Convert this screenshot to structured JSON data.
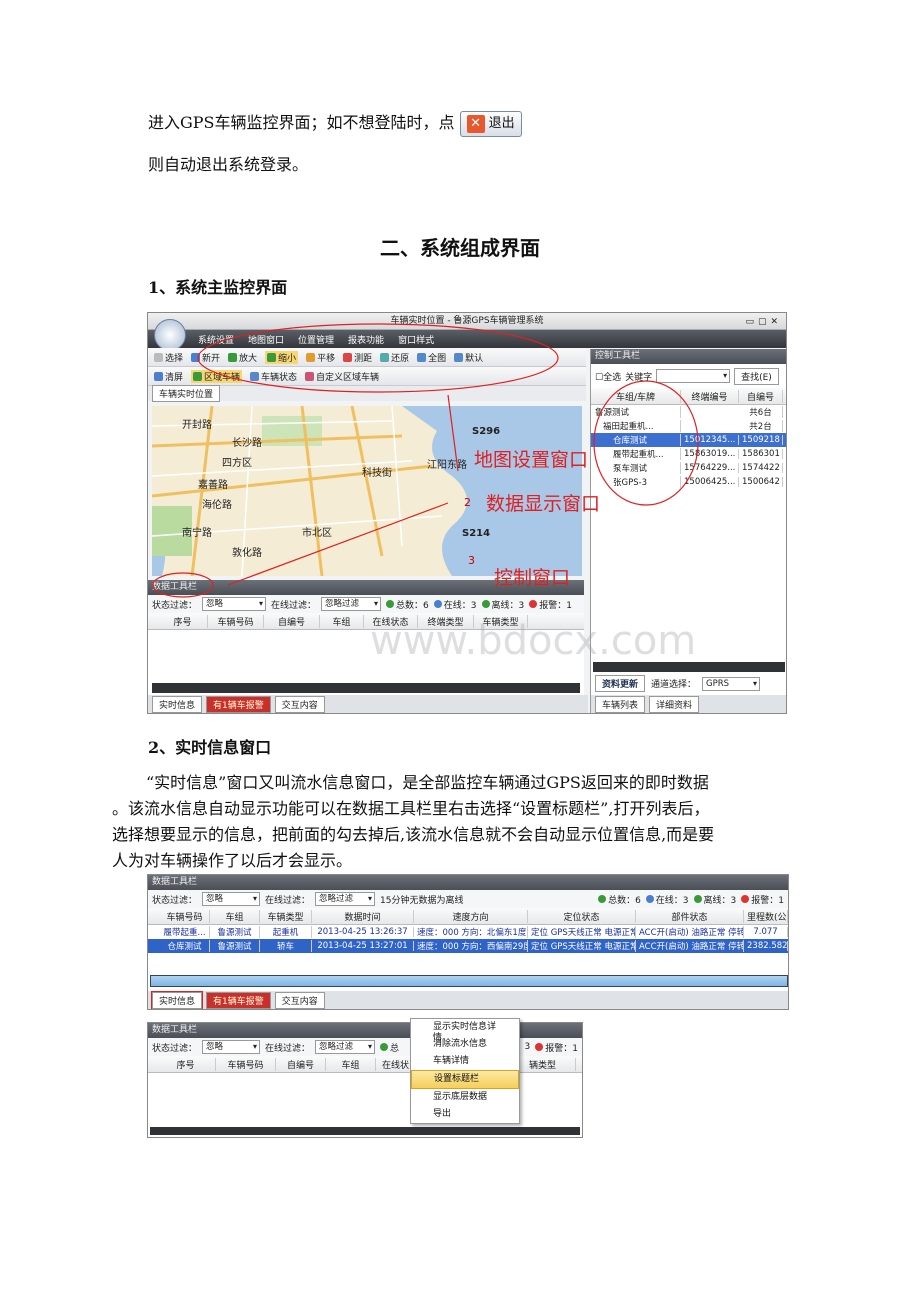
{
  "intro": {
    "line1": "进入GPS车辆监控界面；如不想登陆时，点",
    "exit_button": "退出",
    "line2": "则自动退出系统登录。"
  },
  "section2_title": "二、系统组成界面",
  "sub1_title": "1、系统主监控界面",
  "sub2_title": "2、实时信息窗口",
  "sub2_para": [
    "“实时信息”窗口又叫流水信息窗口，是全部监控车辆通过GPS返回来的即时数据",
    "。该流水信息自动显示功能可以在数据工具栏里右击选择“设置标题栏”,打开列表后，",
    "选择想要显示的信息，把前面的勾去掉后,该流水信息就不会自动显示位置信息,而是要",
    "人为对车辆操作了以后才会显示。"
  ],
  "main_ui": {
    "window_title": "车辆实时位置 - 鲁源GPS车辆管理系统",
    "menu": [
      "系统设置",
      "地图窗口",
      "位置管理",
      "报表功能",
      "窗口样式"
    ],
    "toolbar1": [
      "选择",
      "新开",
      "放大",
      "缩小",
      "平移",
      "测距",
      "还原",
      "全图",
      "默认"
    ],
    "toolbar2": [
      "清屏",
      "区域车辆",
      "车辆状态",
      "自定义区域车辆"
    ],
    "map_tab": "车辆实时位置",
    "map_labels": [
      "开封路",
      "长沙路",
      "四方区",
      "嘉善路",
      "海伦路",
      "南宁路",
      "敦化路",
      "市北区",
      "科技街",
      "S296",
      "S214",
      "江阳东路",
      "2",
      "3"
    ],
    "data_panel_title": "数据工具栏",
    "filter_state_label": "状态过滤：",
    "filter_state_value": "忽略",
    "filter_online_label": "在线过滤：",
    "filter_online_value": "忽略过滤",
    "stats": [
      "总数：6",
      "在线：3",
      "离线：3",
      "报警：1"
    ],
    "columns": [
      "序号",
      "车辆号码",
      "自编号",
      "车组",
      "在线状态",
      "终端类型",
      "车辆类型"
    ],
    "bottom_tabs": [
      "实时信息",
      "有1辆车报警",
      "交互内容"
    ],
    "control_title": "控制工具栏",
    "check_all": "全选",
    "keyword_label": "关键字",
    "search_button": "查找(E)",
    "tree_headers": [
      "车组/车牌",
      "终端编号",
      "自编号"
    ],
    "tree_rows": [
      {
        "name": "鲁源测试",
        "id": "",
        "code": "共6台"
      },
      {
        "name": "福田起重机...",
        "id": "",
        "code": "共2台"
      },
      {
        "name": "仓库测试",
        "id": "15012345...",
        "code": "1509218"
      },
      {
        "name": "履带起重机...",
        "id": "15863019...",
        "code": "1586301"
      },
      {
        "name": "泵车测试",
        "id": "15764229...",
        "code": "1574422"
      },
      {
        "name": "张GPS-3",
        "id": "15006425...",
        "code": "1500642"
      }
    ],
    "control_buttons": [
      "资料更新",
      "通道选择：",
      "GPRS"
    ],
    "control_tabs": [
      "车辆列表",
      "详细资料"
    ],
    "annotations": [
      "地图设置窗口",
      "数据显示窗口",
      "控制窗口"
    ]
  },
  "rt_ui": {
    "title": "数据工具栏",
    "filter_state_label": "状态过滤：",
    "filter_state_value": "忽略",
    "filter_online_label": "在线过滤：",
    "filter_online_value": "忽略过滤",
    "note": "15分钟无数据为离线",
    "stats": [
      "总数：6",
      "在线：3",
      "离线：3",
      "报警：1"
    ],
    "columns": [
      "车辆号码",
      "车组",
      "车辆类型",
      "数据时间",
      "速度方向",
      "定位状态",
      "部件状态",
      "里程数(公"
    ],
    "rows": [
      [
        "履带起重...",
        "鲁源测试",
        "起重机",
        "2013-04-25 13:26:37",
        "速度：000 方向：北偏东1度",
        "定位 GPS天线正常 电源正常",
        "ACC开(启动) 油路正常 停转",
        "7.077"
      ],
      [
        "仓库测试",
        "鲁源测试",
        "轿车",
        "2013-04-25 13:27:01",
        "速度：000 方向：西偏南29度",
        "定位 GPS天线正常 电源正常",
        "ACC开(启动) 油路正常 停转",
        "2382.582"
      ]
    ],
    "tabs": [
      "实时信息",
      "有1辆车报警",
      "交互内容"
    ]
  },
  "ctx_ui": {
    "title": "数据工具栏",
    "filter_state_label": "状态过滤：",
    "filter_state_value": "忽略",
    "filter_online_label": "在线过滤：",
    "filter_online_value": "忽略过滤",
    "stats_partial": [
      "总",
      "3",
      "报警：1"
    ],
    "columns": [
      "序号",
      "车辆号码",
      "自编号",
      "车组",
      "在线状",
      "辆类型"
    ],
    "menu": [
      "显示实时信息详情",
      "消除流水信息",
      "车辆详情",
      "设置标题栏",
      "显示底层数据",
      "导出"
    ]
  },
  "watermark": "www.bdocx.com"
}
